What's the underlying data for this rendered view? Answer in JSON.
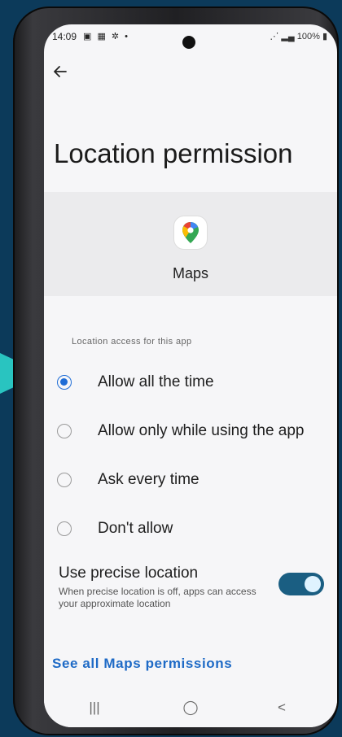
{
  "status_bar": {
    "time": "14:09",
    "left_icons": "▣ ▦ ✲ •",
    "right": "100%"
  },
  "header": {
    "title": "Location permission"
  },
  "app": {
    "name": "Maps"
  },
  "section": {
    "label": "Location access for this app"
  },
  "options": [
    {
      "label": "Allow all the time",
      "selected": true
    },
    {
      "label": "Allow only while using the app",
      "selected": false
    },
    {
      "label": "Ask every time",
      "selected": false
    },
    {
      "label": "Don't allow",
      "selected": false
    }
  ],
  "precise_location": {
    "title": "Use precise location",
    "description": "When precise location is off, apps can access your approximate location",
    "enabled": true
  },
  "see_all": {
    "label": "See all Maps permissions"
  },
  "nav": {
    "recents": "|||",
    "home": "◯",
    "back": "<"
  },
  "colors": {
    "accent_blue": "#1f6dd6",
    "toggle_on": "#1a5e82",
    "background": "#0c3a5a",
    "pointer": "#29c4c0"
  },
  "icons": {
    "back": "arrow-left-icon",
    "app": "maps-pin-icon"
  }
}
